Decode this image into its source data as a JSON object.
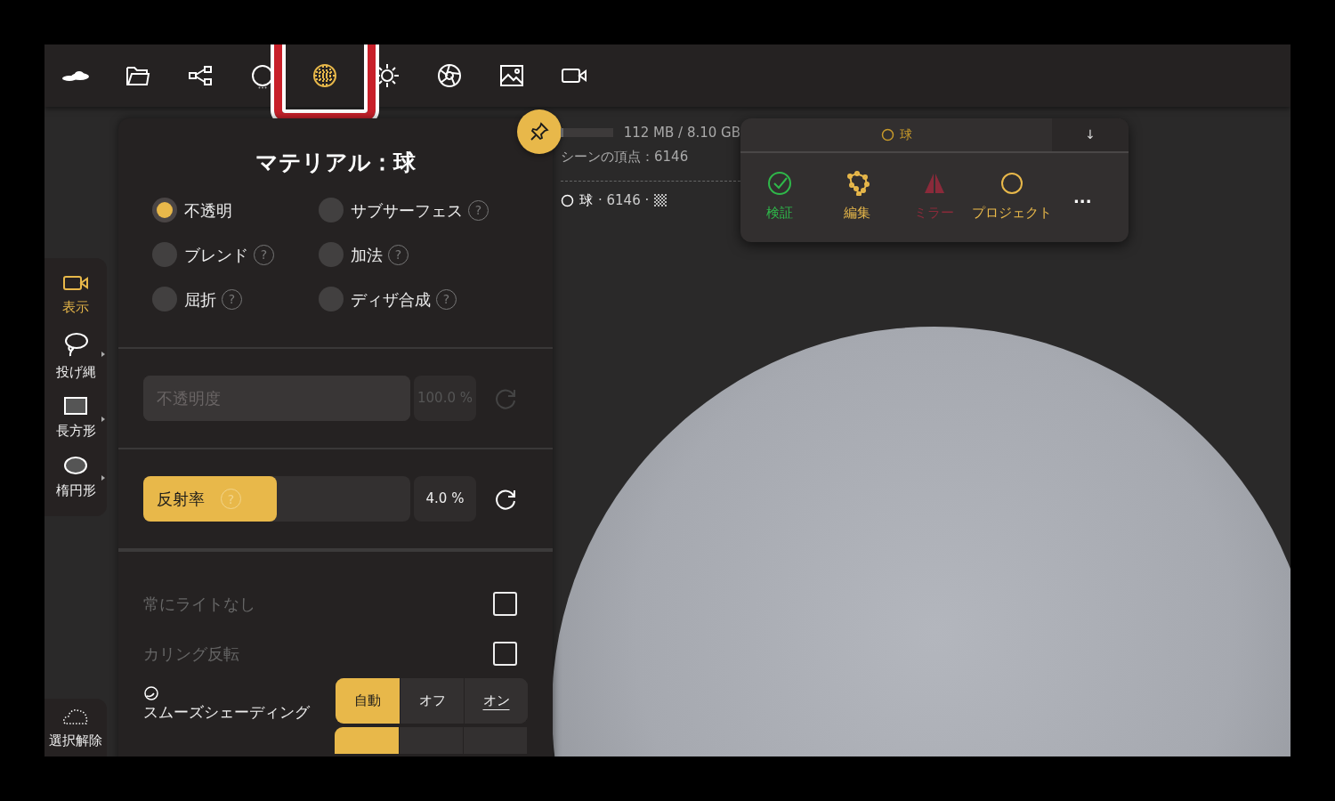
{
  "toolbar": [
    {
      "kind": "logo",
      "selected": false
    },
    {
      "kind": "folder",
      "selected": false
    },
    {
      "kind": "graph",
      "selected": false
    },
    {
      "kind": "circle",
      "selected": false,
      "more": true
    },
    {
      "kind": "material",
      "selected": true
    },
    {
      "kind": "sun",
      "selected": false
    },
    {
      "kind": "aperture",
      "selected": false
    },
    {
      "kind": "image",
      "selected": false
    },
    {
      "kind": "camera",
      "selected": false
    }
  ],
  "side_tools": [
    {
      "kind": "camera",
      "label": "表示",
      "selected": true,
      "submenu": false
    },
    {
      "kind": "lasso",
      "label": "投げ縄",
      "selected": false,
      "submenu": true
    },
    {
      "kind": "rect",
      "label": "長方形",
      "selected": false,
      "submenu": true
    },
    {
      "kind": "ellipse",
      "label": "楕円形",
      "selected": false,
      "submenu": true
    }
  ],
  "deselect": {
    "label": "選択解除"
  },
  "scene_info": {
    "memory": "112 MB / 8.10 GB",
    "vertices": "シーンの頂点：6146",
    "object_name": "球",
    "object_detail": "· 6146 ·"
  },
  "material_panel": {
    "title": "マテリアル：球",
    "shading_modes": [
      {
        "label": "不透明",
        "selected": true
      },
      {
        "label": "サブサーフェス",
        "selected": false,
        "help": "?"
      },
      {
        "label": "ブレンド",
        "selected": false,
        "help": "?"
      },
      {
        "label": "加法",
        "selected": false,
        "help": "?"
      },
      {
        "label": "屈折",
        "selected": false,
        "help": "?"
      },
      {
        "label": "ディザ合成",
        "selected": false,
        "help": "?"
      }
    ],
    "sliders": [
      {
        "label": "不透明度",
        "value": "100.0 %",
        "level": 1,
        "disabled": true
      },
      {
        "label": "反射率",
        "value": "4.0 %",
        "level": 0.5,
        "disabled": false,
        "help": "?"
      }
    ],
    "options": [
      {
        "kind": "checkbox",
        "label": "常にライトなし",
        "checked": false
      },
      {
        "kind": "checkbox",
        "label": "カリング反転",
        "checked": false
      },
      {
        "kind": "segmented",
        "label": "スムーズシェーディング",
        "choices": [
          {
            "label": "自動",
            "selected": true,
            "underlined": false
          },
          {
            "label": "オフ",
            "selected": false,
            "underlined": false
          },
          {
            "label": "オン",
            "selected": false,
            "underlined": true
          }
        ]
      }
    ]
  },
  "object_popover": {
    "title": "球",
    "collapse": "↓",
    "more": "...",
    "actions": [
      {
        "kind": "check",
        "label": "検証",
        "color": "#2fb84a"
      },
      {
        "kind": "edit",
        "label": "編集",
        "color": "#e8b84a"
      },
      {
        "kind": "mirror",
        "label": "ミラー",
        "color": "#8a2a3a"
      },
      {
        "kind": "project",
        "label": "プロジェクト",
        "color": "#e8b84a"
      }
    ]
  }
}
